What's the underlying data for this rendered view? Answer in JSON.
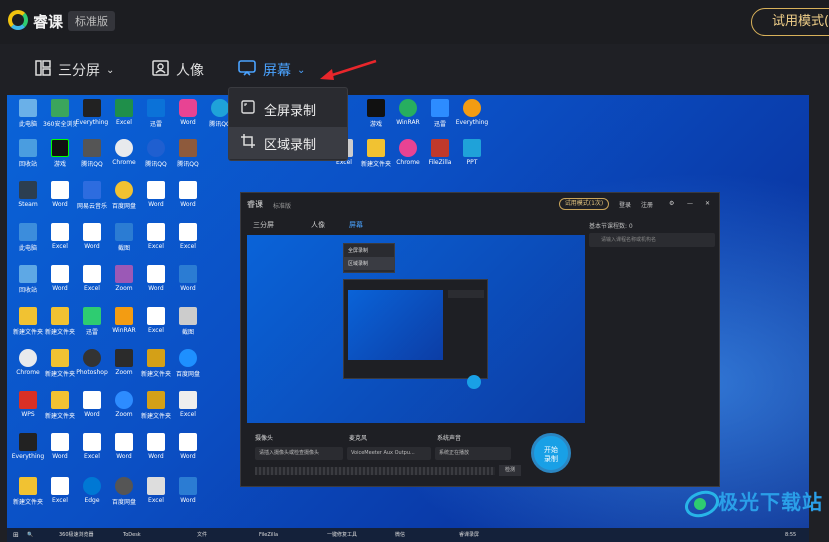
{
  "app": {
    "brand": "睿课",
    "edition": "标准版",
    "trial_button": "试用模式("
  },
  "toolbar": {
    "split": "三分屏",
    "portrait": "人像",
    "screen": "屏幕"
  },
  "dropdown": {
    "fullscreen": "全屏录制",
    "region": "区域录制"
  },
  "desktop": {
    "icons": [
      "此电脑",
      "360安全浏览器",
      "Everything",
      "迅雷",
      "Word",
      "游戏",
      "腾讯QQ",
      "回收站",
      "WPS",
      "Steam",
      "Chrome",
      "Excel",
      "FileZilla",
      "Chrome",
      "PPT",
      "百度网盘",
      "WinRAR",
      "Edge",
      "网易云音乐",
      "新建文件夹",
      "Word",
      "Excel",
      "Photoshop",
      "截图",
      "Zoom"
    ],
    "taskbar": [
      "360极速浏览器",
      "ToDesk",
      "文件",
      "FileZilla",
      "一键修复工具",
      "微信",
      "睿课录屏"
    ],
    "clock": "8:55"
  },
  "inner_window": {
    "title": "睿课",
    "edition": "标准版",
    "trial": "试用模式(1次)",
    "login": "登录",
    "register": "注册",
    "split": "三分屏",
    "portrait": "人像",
    "screen": "屏幕",
    "dd_full": "全屏录制",
    "dd_region": "区域录制",
    "side_label": "基本节课程数: 0",
    "search_placeholder": "请输入课程名称或机构名",
    "camera": "摄像头",
    "mic": "麦克风",
    "sound": "系统声音",
    "camera_val": "请插入摄像头或检查摄像头",
    "mic_val": "VoiceMeeter Aux Outpu...",
    "sound_val": "系统正在播放",
    "check": "检测",
    "start": "开始\n录制"
  },
  "watermark": {
    "text": "极光下载站"
  }
}
